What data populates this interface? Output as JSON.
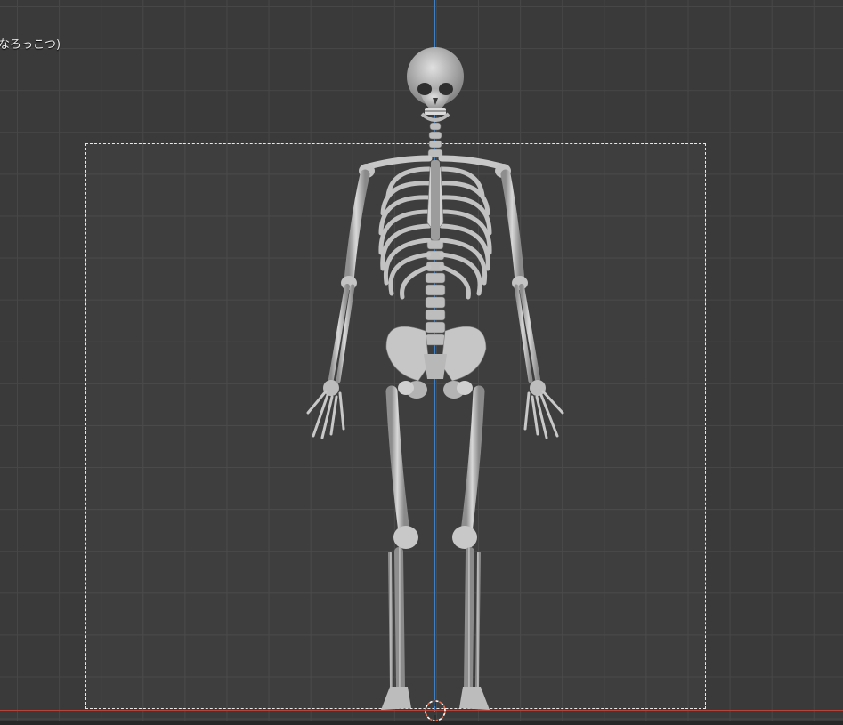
{
  "viewport": {
    "object_label": "なろっこつ)"
  },
  "colors": {
    "background": "#3a3a3a",
    "grid": "#474747",
    "z_axis": "#3f7fc4",
    "x_axis": "#b6423a",
    "bone": "#c9c9c9",
    "camera_frame": "#e8e8e8"
  },
  "icons": {
    "origin_cursor": "3d-cursor-icon"
  }
}
